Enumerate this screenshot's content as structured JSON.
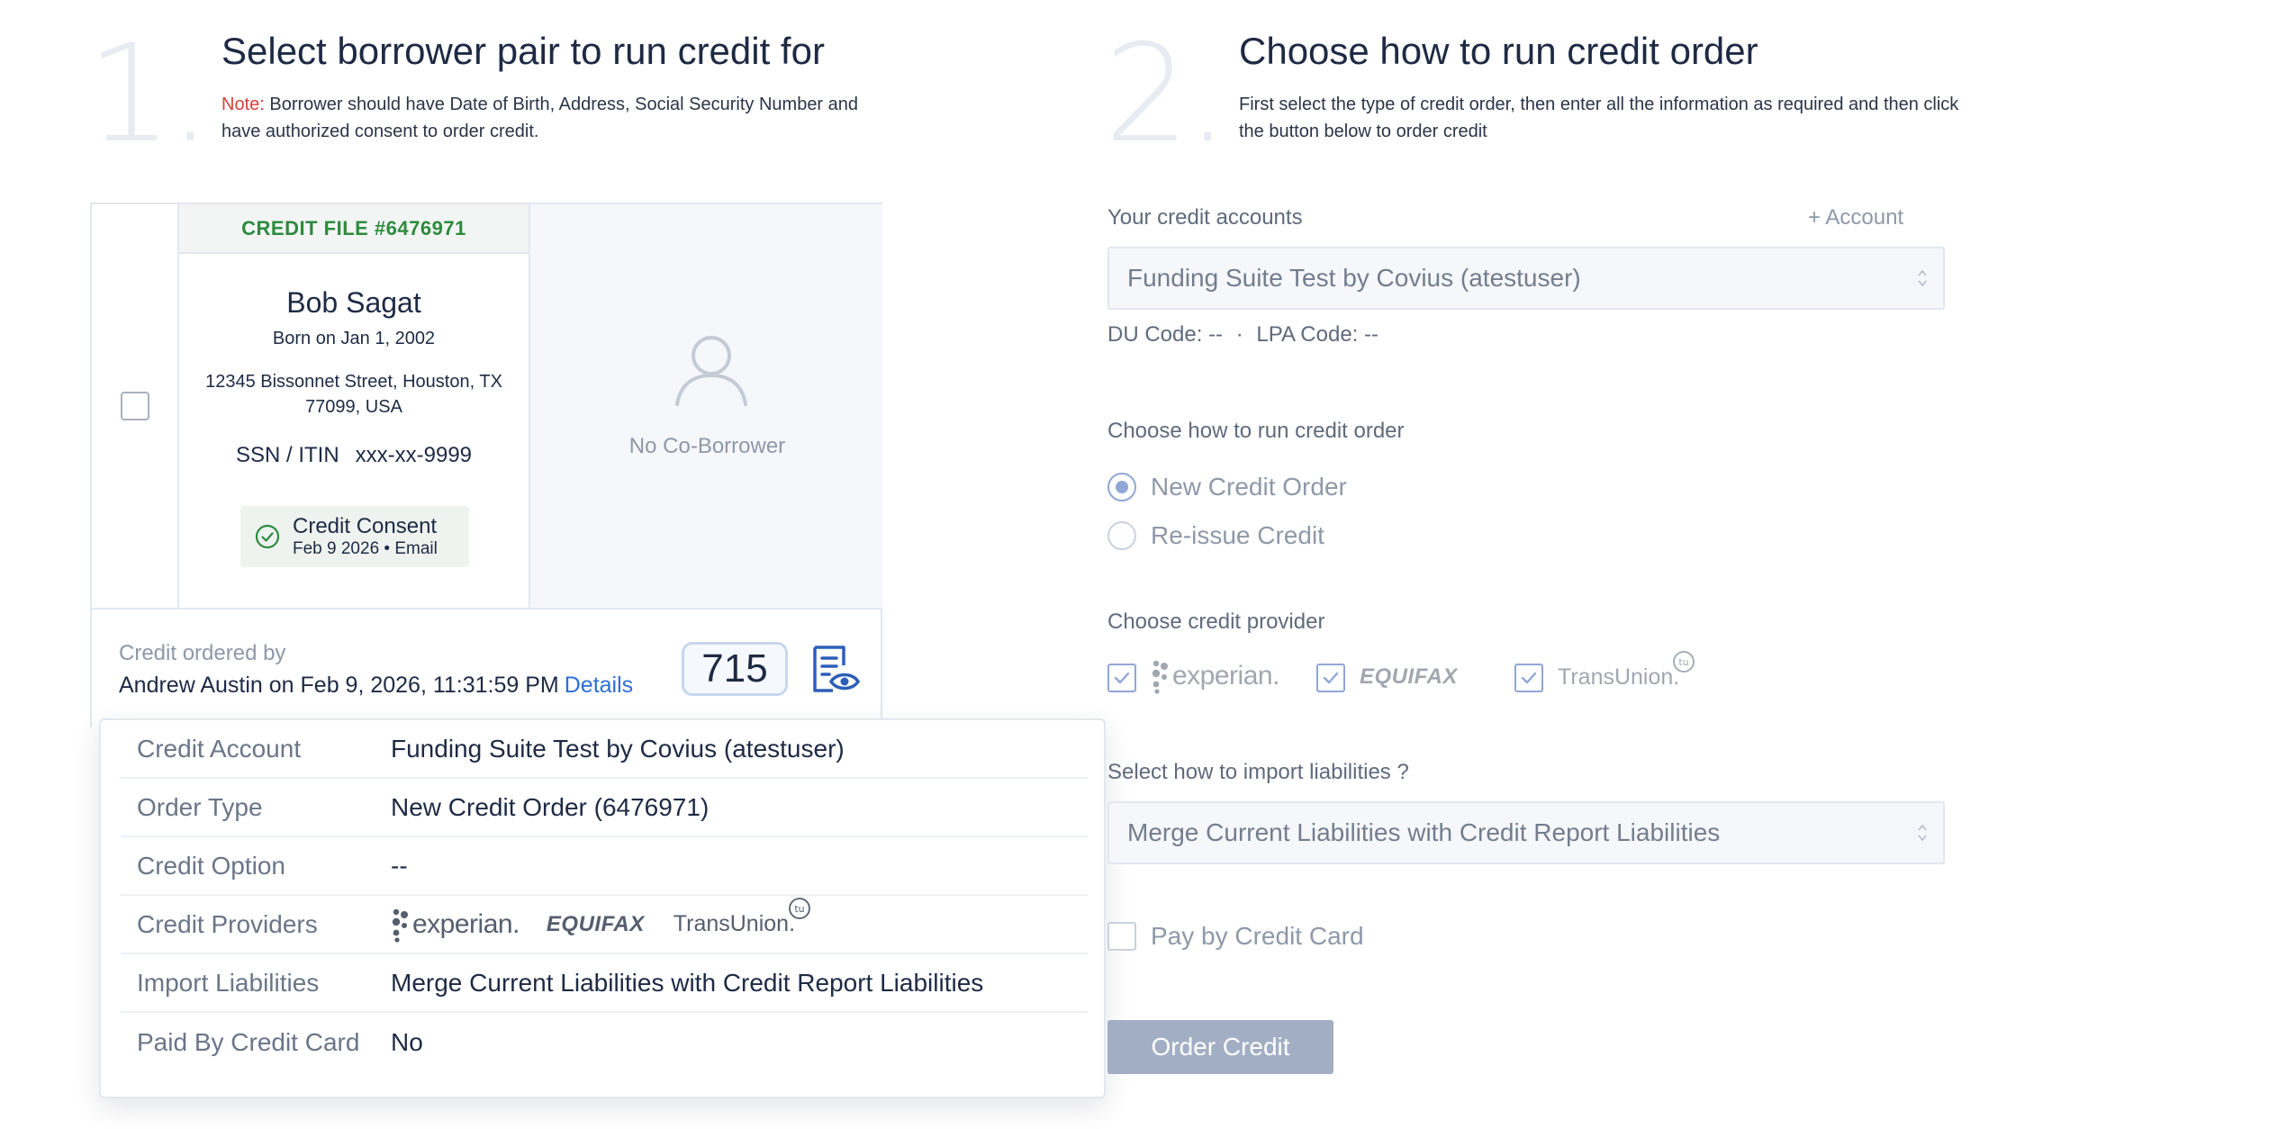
{
  "step1": {
    "number": "1.",
    "title": "Select borrower pair to run credit for",
    "note_label": "Note:",
    "note_text": " Borrower should have Date of Birth, Address, Social Security Number and have authorized consent to order credit."
  },
  "credit_file": {
    "header": "CREDIT FILE #6476971",
    "borrower_name": "Bob Sagat",
    "born": "Born on Jan 1, 2002",
    "address": "12345 Bissonnet Street, Houston, TX 77099, USA",
    "ssn_label": "SSN / ITIN",
    "ssn_value": "xxx-xx-9999",
    "consent_title": "Credit Consent",
    "consent_sub": "Feb 9 2026 • Email",
    "coborrower_label": "No Co-Borrower",
    "ordered_by_label": "Credit ordered by",
    "ordered_by": "Andrew Austin on Feb 9, 2026, 11:31:59 PM",
    "details_link": "Details",
    "score": "715"
  },
  "details_popover": {
    "rows": [
      {
        "key": "Credit Account",
        "value": "Funding Suite Test by Covius (atestuser)"
      },
      {
        "key": "Order Type",
        "value": "New Credit Order (6476971)"
      },
      {
        "key": "Credit Option",
        "value": "--"
      },
      {
        "key": "Credit Providers",
        "value": ""
      },
      {
        "key": "Import Liabilities",
        "value": "Merge Current Liabilities with Credit Report Liabilities"
      },
      {
        "key": "Paid By Credit Card",
        "value": "No"
      }
    ]
  },
  "logos": {
    "experian": "experian.",
    "equifax": "EQUIFAX",
    "transunion": "TransUnion.",
    "tu_badge": "tu"
  },
  "step2": {
    "number": "2.",
    "title": "Choose how to run credit order",
    "desc": "First select the type of credit order, then enter all the information as required and then click the button below to order credit",
    "accounts_label": "Your credit accounts",
    "add_account": "+ Account",
    "account_selected": "Funding Suite Test by Covius (atestuser)",
    "du_code": "DU Code: --",
    "separator": "·",
    "lpa_code": "LPA Code: --",
    "run_label": "Choose how to run credit order",
    "option_new": "New Credit Order",
    "option_reissue": "Re-issue Credit",
    "selected_option": "New Credit Order",
    "provider_label": "Choose credit provider",
    "liabilities_label": "Select how to import liabilities ?",
    "liabilities_selected": "Merge Current Liabilities with Credit Report Liabilities",
    "pay_label": "Pay by Credit Card",
    "order_button": "Order Credit"
  },
  "colors": {
    "accent_green": "#2d8a3e",
    "link_blue": "#2d6fd6",
    "note_red": "#d6423a",
    "disabled_button": "#a2aec4"
  }
}
